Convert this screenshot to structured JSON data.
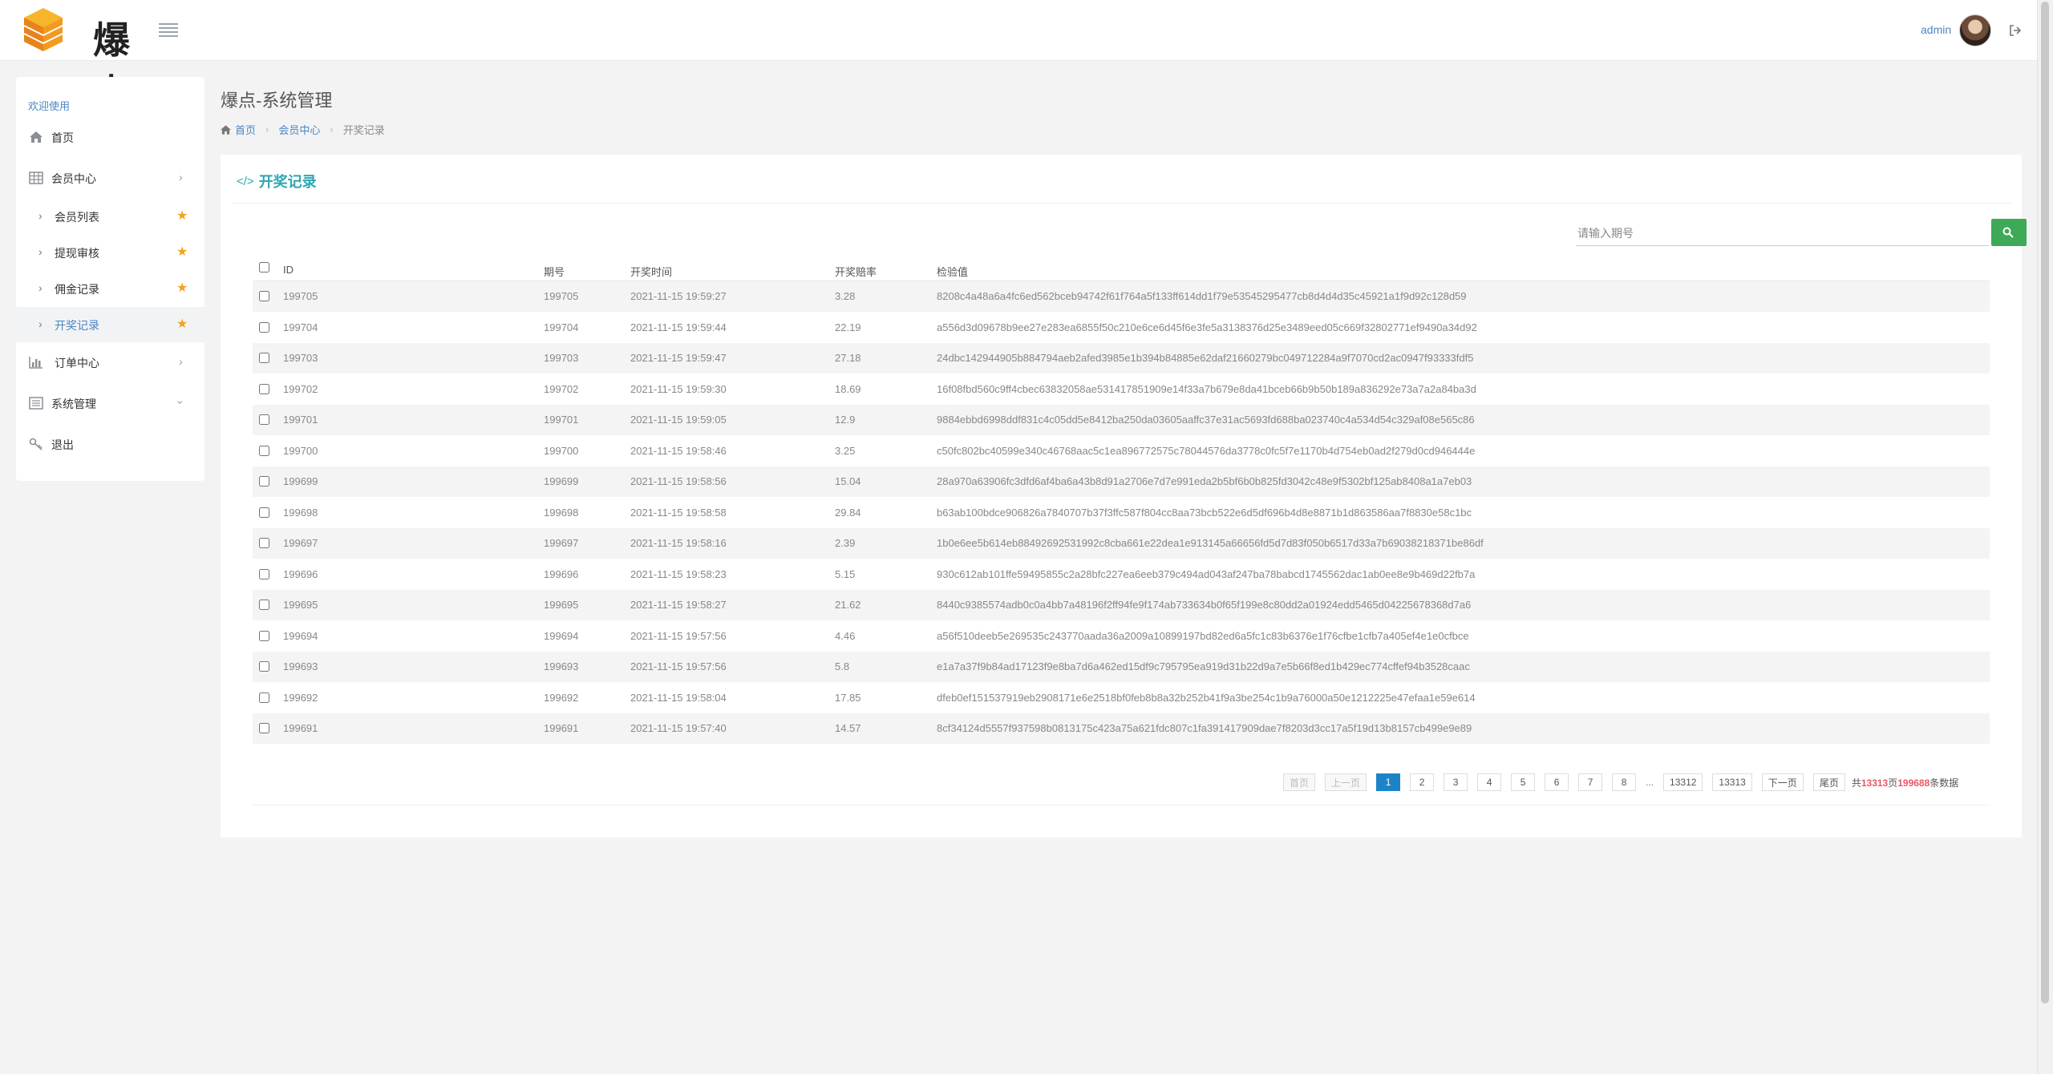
{
  "header": {
    "logo_text": "爆点",
    "user": "admin"
  },
  "sidebar": {
    "welcome": "欢迎使用",
    "items": [
      {
        "label": "首页",
        "icon": "home-icon"
      },
      {
        "label": "会员中心",
        "icon": "table-icon"
      },
      {
        "label": "订单中心",
        "icon": "bar-chart-icon"
      },
      {
        "label": "系统管理",
        "icon": "list-alt-icon"
      },
      {
        "label": "退出",
        "icon": "key-icon"
      }
    ],
    "sub_items": [
      {
        "label": "会员列表"
      },
      {
        "label": "提现审核"
      },
      {
        "label": "佣金记录"
      },
      {
        "label": "开奖记录",
        "active": true
      }
    ]
  },
  "page": {
    "title": "爆点-系统管理",
    "breadcrumb": [
      "首页",
      "会员中心",
      "开奖记录"
    ]
  },
  "panel": {
    "title": "开奖记录",
    "search_placeholder": "请输入期号"
  },
  "table": {
    "columns": [
      "ID",
      "期号",
      "开奖时间",
      "开奖赔率",
      "检验值"
    ],
    "rows": [
      {
        "id": "199705",
        "issue": "199705",
        "time": "2021-11-15 19:59:27",
        "rate": "3.28",
        "hash": "8208c4a48a6a4fc6ed562bceb94742f61f764a5f133ff614dd1f79e53545295477cb8d4d4d35c45921a1f9d92c128d59"
      },
      {
        "id": "199704",
        "issue": "199704",
        "time": "2021-11-15 19:59:44",
        "rate": "22.19",
        "hash": "a556d3d09678b9ee27e283ea6855f50c210e6ce6d45f6e3fe5a3138376d25e3489eed05c669f32802771ef9490a34d92"
      },
      {
        "id": "199703",
        "issue": "199703",
        "time": "2021-11-15 19:59:47",
        "rate": "27.18",
        "hash": "24dbc142944905b884794aeb2afed3985e1b394b84885e62daf21660279bc049712284a9f7070cd2ac0947f93333fdf5"
      },
      {
        "id": "199702",
        "issue": "199702",
        "time": "2021-11-15 19:59:30",
        "rate": "18.69",
        "hash": "16f08fbd560c9ff4cbec63832058ae531417851909e14f33a7b679e8da41bceb66b9b50b189a836292e73a7a2a84ba3d"
      },
      {
        "id": "199701",
        "issue": "199701",
        "time": "2021-11-15 19:59:05",
        "rate": "12.9",
        "hash": "9884ebbd6998ddf831c4c05dd5e8412ba250da03605aaffc37e31ac5693fd688ba023740c4a534d54c329af08e565c86"
      },
      {
        "id": "199700",
        "issue": "199700",
        "time": "2021-11-15 19:58:46",
        "rate": "3.25",
        "hash": "c50fc802bc40599e340c46768aac5c1ea896772575c78044576da3778c0fc5f7e1170b4d754eb0ad2f279d0cd946444e"
      },
      {
        "id": "199699",
        "issue": "199699",
        "time": "2021-11-15 19:58:56",
        "rate": "15.04",
        "hash": "28a970a63906fc3dfd6af4ba6a43b8d91a2706e7d7e991eda2b5bf6b0b825fd3042c48e9f5302bf125ab8408a1a7eb03"
      },
      {
        "id": "199698",
        "issue": "199698",
        "time": "2021-11-15 19:58:58",
        "rate": "29.84",
        "hash": "b63ab100bdce906826a7840707b37f3ffc587f804cc8aa73bcb522e6d5df696b4d8e8871b1d863586aa7f8830e58c1bc"
      },
      {
        "id": "199697",
        "issue": "199697",
        "time": "2021-11-15 19:58:16",
        "rate": "2.39",
        "hash": "1b0e6ee5b614eb88492692531992c8cba661e22dea1e913145a66656fd5d7d83f050b6517d33a7b69038218371be86df"
      },
      {
        "id": "199696",
        "issue": "199696",
        "time": "2021-11-15 19:58:23",
        "rate": "5.15",
        "hash": "930c612ab101ffe59495855c2a28bfc227ea6eeb379c494ad043af247ba78babcd1745562dac1ab0ee8e9b469d22fb7a"
      },
      {
        "id": "199695",
        "issue": "199695",
        "time": "2021-11-15 19:58:27",
        "rate": "21.62",
        "hash": "8440c9385574adb0c0a4bb7a48196f2ff94fe9f174ab733634b0f65f199e8c80dd2a01924edd5465d04225678368d7a6"
      },
      {
        "id": "199694",
        "issue": "199694",
        "time": "2021-11-15 19:57:56",
        "rate": "4.46",
        "hash": "a56f510deeb5e269535c243770aada36a2009a10899197bd82ed6a5fc1c83b6376e1f76cfbe1cfb7a405ef4e1e0cfbce"
      },
      {
        "id": "199693",
        "issue": "199693",
        "time": "2021-11-15 19:57:56",
        "rate": "5.8",
        "hash": "e1a7a37f9b84ad17123f9e8ba7d6a462ed15df9c795795ea919d31b22d9a7e5b66f8ed1b429ec774cffef94b3528caac"
      },
      {
        "id": "199692",
        "issue": "199692",
        "time": "2021-11-15 19:58:04",
        "rate": "17.85",
        "hash": "dfeb0ef151537919eb2908171e6e2518bf0feb8b8a32b252b41f9a3be254c1b9a76000a50e1212225e47efaa1e59e614"
      },
      {
        "id": "199691",
        "issue": "199691",
        "time": "2021-11-15 19:57:40",
        "rate": "14.57",
        "hash": "8cf34124d5557f937598b0813175c423a75a621fdc807c1fa391417909dae7f8203d3cc17a5f19d13b8157cb499e9e89"
      }
    ]
  },
  "pagination": {
    "first": "首页",
    "prev": "上一页",
    "pages": [
      "1",
      "2",
      "3",
      "4",
      "5",
      "6",
      "7",
      "8"
    ],
    "current": "1",
    "ellipsis": "...",
    "tail_pages": [
      "13312",
      "13313"
    ],
    "next": "下一页",
    "last": "尾页",
    "summary_prefix": "共",
    "total_pages": "13313",
    "summary_mid": "页",
    "total_records": "199688",
    "summary_suffix": "条数据"
  },
  "colors": {
    "accent": "#2fa6b3",
    "link": "#4b86c3",
    "search_button": "#3ea956",
    "page_current": "#1c84c6",
    "star": "#f0a31e",
    "highlight": "#ed5565"
  }
}
